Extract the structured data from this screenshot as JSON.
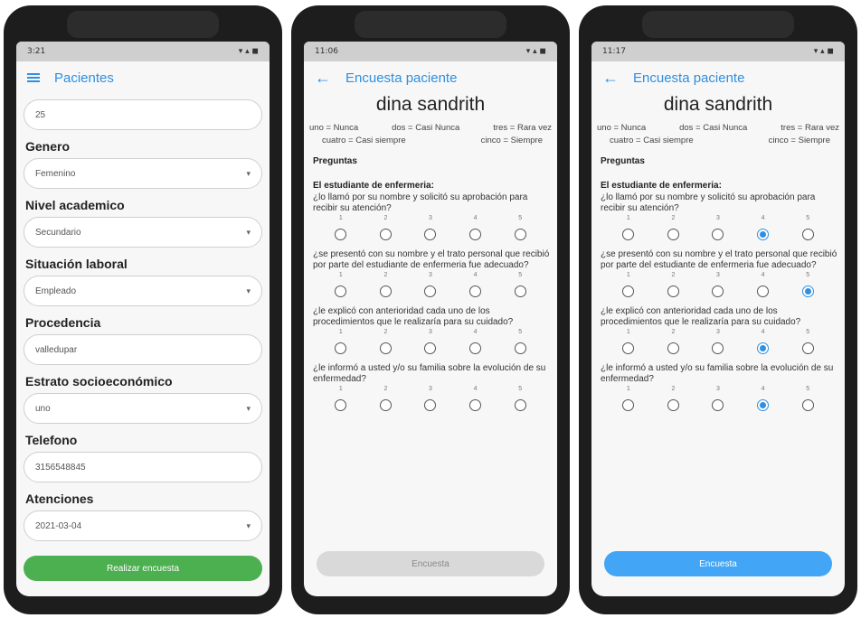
{
  "phones": [
    {
      "status_time": "3:21",
      "title": "Pacientes",
      "age_value": "25",
      "fields": [
        {
          "label": "Genero",
          "value": "Femenino"
        },
        {
          "label": "Nivel academico",
          "value": "Secundario"
        },
        {
          "label": "Situación laboral",
          "value": "Empleado"
        },
        {
          "label": "Procedencia",
          "value": "valledupar"
        },
        {
          "label": "Estrato socioeconómico",
          "value": "uno"
        },
        {
          "label": "Telefono",
          "value": "3156548845"
        },
        {
          "label": "Atenciones",
          "value": "2021-03-04"
        }
      ],
      "button": "Realizar encuesta"
    },
    {
      "status_time": "11:06",
      "title": "Encuesta paciente",
      "patient": "dina sandrith",
      "legend": [
        "uno = Nunca",
        "dos = Casi Nunca",
        "tres = Rara vez",
        "cuatro = Casi siempre",
        "cinco = Siempre"
      ],
      "section": "Preguntas",
      "intro": "El estudiante de enfermeria:",
      "questions": [
        "¿lo llamó por su nombre y solicitó su aprobación para recibir su atención?",
        "¿se presentó con su nombre y el trato personal que recibió por parte del estudiante de enfermeria fue adecuado?",
        "¿le explicó con anterioridad cada uno de los procedimientos que le realizaría para su cuidado?",
        "¿le informó a usted y/o su familia sobre la evolución de su enfermedad?"
      ],
      "scale": [
        "1",
        "2",
        "3",
        "4",
        "5"
      ],
      "selected": [
        0,
        0,
        0,
        0
      ],
      "button": "Encuesta"
    },
    {
      "status_time": "11:17",
      "title": "Encuesta paciente",
      "patient": "dina sandrith",
      "legend": [
        "uno = Nunca",
        "dos = Casi Nunca",
        "tres = Rara vez",
        "cuatro = Casi siempre",
        "cinco = Siempre"
      ],
      "section": "Preguntas",
      "intro": "El estudiante de enfermeria:",
      "questions": [
        "¿lo llamó por su nombre y solicitó su aprobación para recibir su atención?",
        "¿se presentó con su nombre y el trato personal que recibió por parte del estudiante de enfermeria fue adecuado?",
        "¿le explicó con anterioridad cada uno de los procedimientos que le realizaría para su cuidado?",
        "¿le informó a usted y/o su familia sobre la evolución de su enfermedad?"
      ],
      "scale": [
        "1",
        "2",
        "3",
        "4",
        "5"
      ],
      "selected": [
        4,
        5,
        4,
        4
      ],
      "button": "Encuesta"
    }
  ],
  "colors": {
    "accent": "#2f8fe0",
    "green": "#4caf50",
    "blue": "#42a5f5"
  },
  "icons": [
    "menu-icon",
    "back-arrow-icon",
    "dropdown-caret-icon",
    "radio-icon"
  ]
}
